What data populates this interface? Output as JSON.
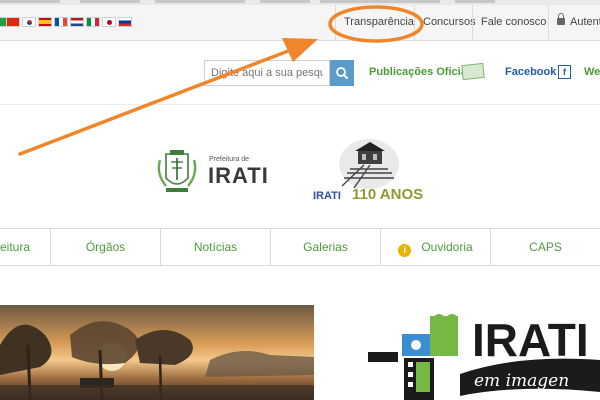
{
  "top_bar": {
    "flags": [
      {
        "name": "brazil-flag"
      },
      {
        "name": "china-flag"
      },
      {
        "name": "south-korea-flag"
      },
      {
        "name": "spain-flag"
      },
      {
        "name": "france-flag"
      },
      {
        "name": "netherlands-flag"
      },
      {
        "name": "italy-flag"
      },
      {
        "name": "japan-flag"
      },
      {
        "name": "russia-flag"
      }
    ],
    "links": {
      "transparencia": "Transparência",
      "concursos": "Concursos",
      "fale_conosco": "Fale conosco",
      "autenticacao": "Autentic"
    }
  },
  "header": {
    "search": {
      "placeholder": "Digite aqui a sua pesquisa"
    },
    "publicacoes_label": "Publicações Oficiais",
    "facebook_label": "Facebook",
    "facebook_icon": "f",
    "web_label": "We"
  },
  "logos": {
    "prefeitura_small": "Prefeitura de",
    "prefeitura_big": "IRATI",
    "anniversary_city": "IRATI",
    "anniversary_years": "110 ANOS"
  },
  "nav": {
    "items": [
      "eitura",
      "Órgãos",
      "Notícias",
      "Galerias",
      "Ouvidoria",
      "CAPS"
    ],
    "ouvidoria_icon": "i"
  },
  "banners": {
    "irati_em_imagens_title": "IRATI",
    "irati_em_imagens_script": "em imagen"
  },
  "annotation": {
    "highlight_color": "#f0862a"
  },
  "colors": {
    "nav_text": "#4e9b3b",
    "search_button": "#5b9bc9",
    "facebook": "#1f5fa8"
  }
}
